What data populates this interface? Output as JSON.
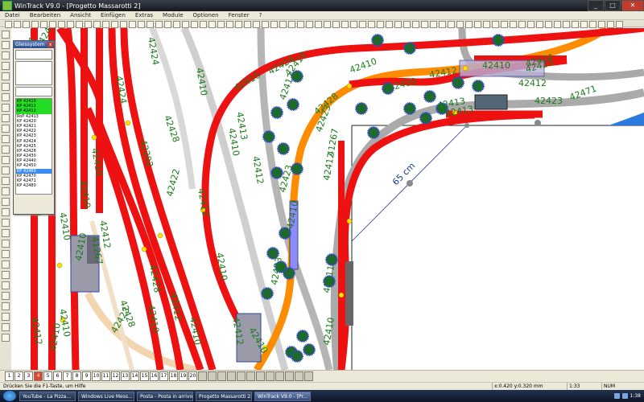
{
  "window": {
    "title": "WinTrack V9.0 - [Progetto Massarotti 2]",
    "buttons": {
      "minimize": "_",
      "maximize": "□",
      "close": "✕"
    }
  },
  "menu": [
    "Datei",
    "Bearbeiten",
    "Ansicht",
    "Einfügen",
    "Extras",
    "Module",
    "Optionen",
    "Fenster",
    "?"
  ],
  "palette": {
    "title": "Gleissystem",
    "close": "x",
    "items": [
      "KP 42410",
      "KP 42411",
      "KP 42412",
      "RoP 42413",
      "KP 42420",
      "KP 42421",
      "KP 42422",
      "KP 42423",
      "KP 42424",
      "KP 42425",
      "KP 42428",
      "KP 42430",
      "KP 42440",
      "KP 42450",
      "KP 42460",
      "KP 42470",
      "KP 42471",
      "KP 42480"
    ]
  },
  "track_labels": [
    "42424",
    "42410",
    "42412",
    "42423",
    "42410",
    "42410",
    "42412",
    "42424",
    "42471",
    "42413",
    "42423",
    "42428",
    "42410",
    "42423",
    "42423",
    "42424",
    "42202",
    "42413",
    "42410",
    "42422",
    "42412",
    "42428",
    "42410",
    "42410",
    "42412",
    "42423",
    "42410",
    "42428",
    "42410",
    "42424",
    "42410",
    "42410",
    "42410",
    "42412",
    "42410",
    "42412",
    "42413",
    "41267",
    "42412",
    "42423",
    "41267",
    "42410",
    "42411",
    "42412",
    "42410",
    "42424",
    "42412",
    "42410",
    "42428",
    "42410",
    "42413",
    "42410",
    "42410",
    "42412",
    "42410"
  ],
  "measure_label": "65 cm",
  "layers": [
    "1",
    "2",
    "3",
    "4",
    "5",
    "6",
    "7",
    "8",
    "9",
    "10",
    "11",
    "12",
    "13",
    "14",
    "15",
    "16",
    "17",
    "18",
    "19",
    "20"
  ],
  "status": {
    "hint": "Drücken Sie die F1-Taste, um Hilfe",
    "coords": "x:0.420 y:0.320 mm",
    "zoom": "1:33",
    "num": "NUM"
  },
  "taskbar": {
    "tasks": [
      "YouTube - La Pizza...",
      "Windows Live Mess...",
      "Posta - Posta in arrivo",
      "Progetto Massarotti 2...",
      "WinTrack V9.0 - [Pr..."
    ],
    "clock": "1:38"
  }
}
